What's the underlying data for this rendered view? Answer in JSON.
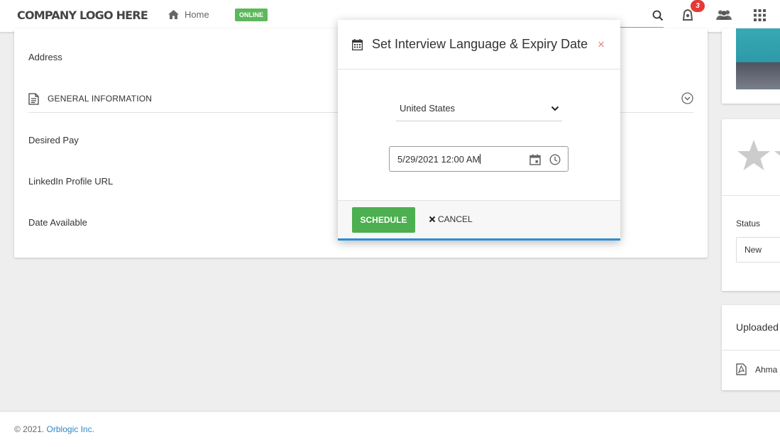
{
  "header": {
    "logo_text": "COMPANY LOGO HERE",
    "home_label": "Home",
    "online_badge": "ONLINE",
    "notification_count": "3",
    "icons": [
      "home-icon",
      "search-icon",
      "bell-icon",
      "users-icon",
      "apps-grid-icon"
    ]
  },
  "main_card": {
    "address_label": "Address",
    "section_general": "GENERAL INFORMATION",
    "desired_pay_label": "Desired Pay",
    "linkedin_label": "LinkedIn Profile URL",
    "date_available_label": "Date Available"
  },
  "right_panel": {
    "status_label": "Status",
    "status_value": "New",
    "uploaded_title": "Uploaded",
    "file_name": "Ahma"
  },
  "modal": {
    "title": "Set Interview Language & Expiry Date",
    "close_symbol": "×",
    "language_value": "United States",
    "datetime_value": "5/29/2021 12:00 AM",
    "schedule_label": "SCHEDULE",
    "cancel_label": "CANCEL"
  },
  "footer": {
    "copyright": "© 2021. ",
    "company_link": "Orblogic Inc."
  },
  "colors": {
    "accent_blue": "#2a8fd4",
    "success_green": "#4caf50",
    "online_green": "#5cb85c",
    "badge_red": "#e53935",
    "close_red": "#e8826f"
  }
}
